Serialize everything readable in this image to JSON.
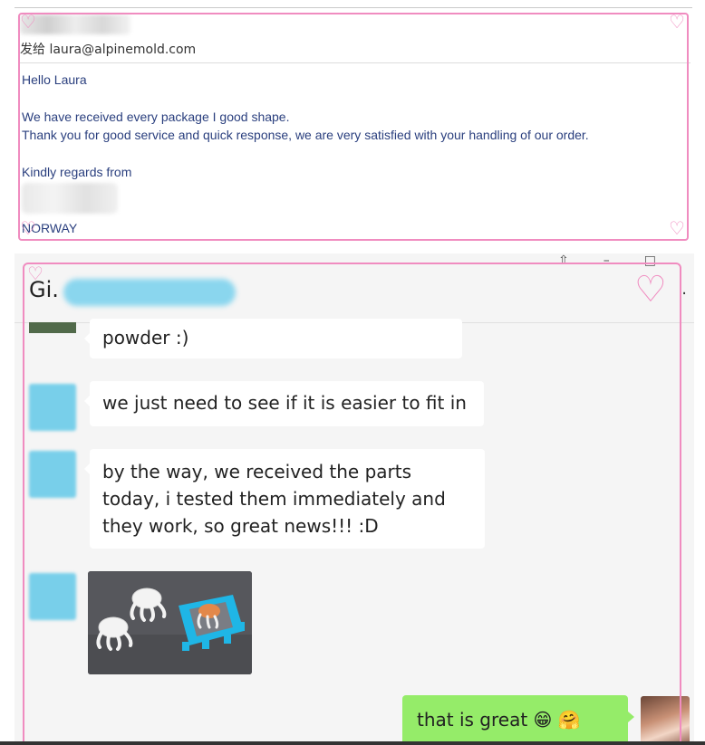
{
  "email": {
    "to_label": "发给",
    "to_address": "laura@alpinemold.com",
    "greeting": "Hello Laura",
    "line1": "We have received every package I good shape.",
    "line2": "Thank you for good service and quick response, we are very satisfied with your handling of our order.",
    "closing": "Kindly regards from",
    "country": "NORWAY"
  },
  "chat": {
    "window_controls": [
      "⇧",
      "–",
      "□"
    ],
    "title_visible": "Gi.",
    "more": "·",
    "messages": [
      {
        "text": "powder  :)"
      },
      {
        "text": "we just need to see if it is easier to fit in"
      },
      {
        "text": "by the way, we received the parts today, i tested them immediately and they work, so great news!!!  :D"
      },
      {
        "type": "image"
      },
      {
        "text": "that is great 😁 🤗",
        "self": true
      }
    ]
  },
  "colors": {
    "frame": "#f08cc0",
    "bubble_self": "#95ec69",
    "bubble_other": "#ffffff",
    "email_text": "#2a3f7e"
  }
}
